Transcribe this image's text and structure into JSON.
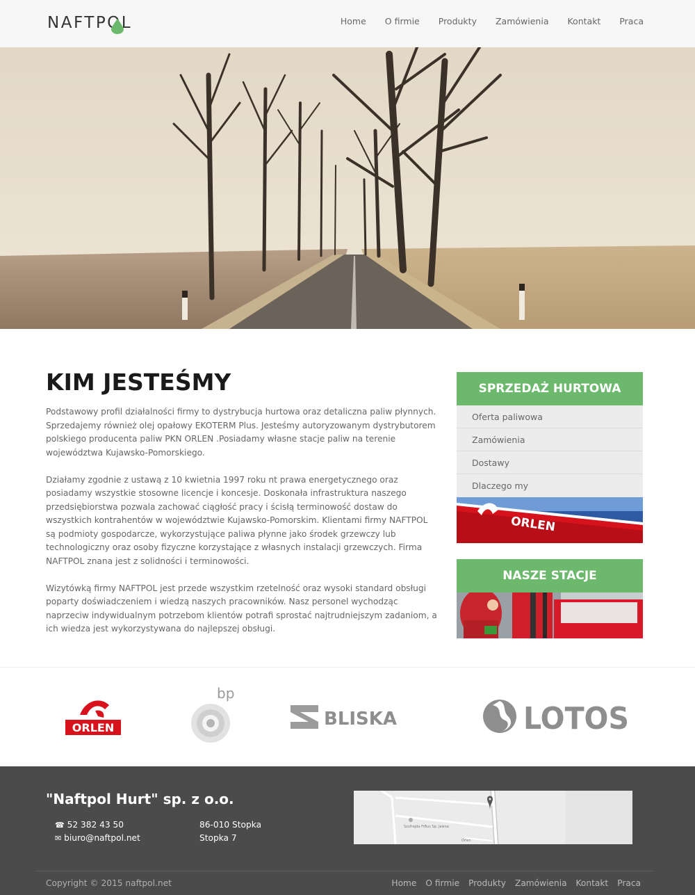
{
  "header": {
    "logo_text": "NAFTPOL",
    "nav": [
      "Home",
      "O firmie",
      "Produkty",
      "Zamówienia",
      "Kontakt",
      "Praca"
    ]
  },
  "main": {
    "title": "KIM JESTEŚMY",
    "paragraphs": [
      "Podstawowy profil działalności firmy to dystrybucja hurtowa oraz detaliczna paliw płynnych. Sprzedajemy również olej opałowy EKOTERM Plus. Jesteśmy autoryzowanym dystrybutorem polskiego producenta paliw PKN ORLEN .Posiadamy własne stacje paliw na terenie województwa Kujawsko-Pomorskiego.",
      "Działamy zgodnie z ustawą z 10 kwietnia 1997 roku nt prawa energetycznego oraz posiadamy wszystkie stosowne licencje i koncesje. Doskonała infrastruktura naszego przedsiębiorstwa pozwala zachować ciągłość pracy i ścisłą terminowość dostaw do wszystkich kontrahentów w województwie Kujawsko-Pomorskim. Klientami firmy NAFTPOL są podmioty gospodarcze, wykorzystujące paliwa płynne jako środek grzewczy lub technologiczny oraz osoby fizyczne korzystające z własnych instalacji grzewczych. Firma NAFTPOL znana jest z solidności i terminowości.",
      "Wizytówką firmy NAFTPOL jest przede wszystkim rzetelność oraz wysoki standard obsługi poparty doświadczeniem i wiedzą naszych pracowników. Nasz personel wychodząc naprzeciw indywidualnym potrzebom klientów potrafi sprostać najtrudniejszym zadaniom, a ich wiedza jest wykorzystywana do najlepszej obsługi."
    ]
  },
  "sidebar": {
    "wholesale": {
      "title": "SPRZEDAŻ HURTOWA",
      "items": [
        "Oferta paliwowa",
        "Zamówienia",
        "Dostawy",
        "Dlaczego my"
      ],
      "image_sign": "ORLEN"
    },
    "stations": {
      "title": "NASZE STACJE"
    }
  },
  "partners": {
    "logos": [
      "ORLEN",
      "bp",
      "BLISKA",
      "LOTOS"
    ]
  },
  "footer": {
    "company": "\"Naftpol Hurt\" sp. z o.o.",
    "phone": "52 382 43 50",
    "email": "biuro@naftpol.net",
    "address_line1": "86-010 Stopka",
    "address_line2": "Stopka 7",
    "copyright": "Copyright © 2015 naftpol.net",
    "nav": [
      "Home",
      "O firmie",
      "Produkty",
      "Zamówienia",
      "Kontakt",
      "Praca"
    ],
    "map_labels": [
      "Szufrajda FrBus Sp. Jawna",
      "Orlen"
    ]
  },
  "colors": {
    "accent_green": "#6cb86c",
    "footer_bg": "#4b4b4b",
    "header_bg": "#f7f7f7",
    "orlen_red": "#d6121d"
  },
  "icons": [
    "logo-drop-icon",
    "phone-icon",
    "envelope-icon",
    "map-pin-icon"
  ]
}
